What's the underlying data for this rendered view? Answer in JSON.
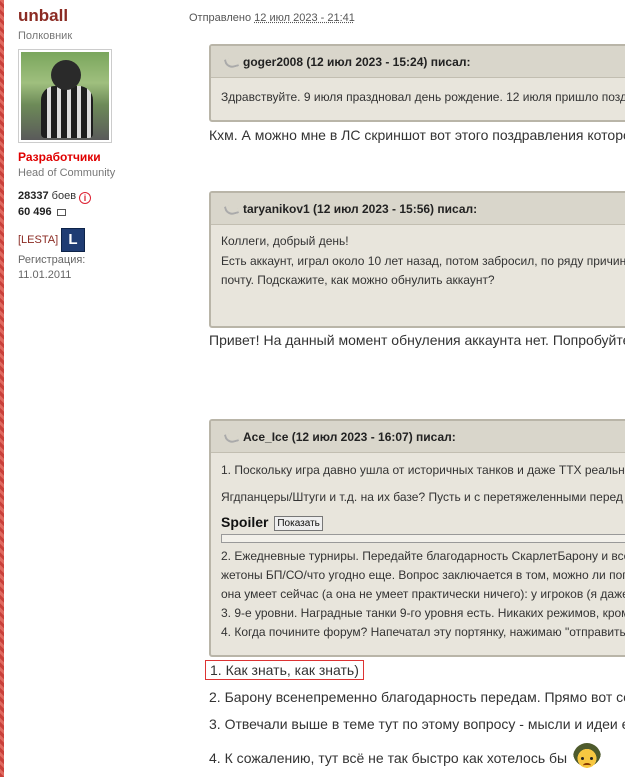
{
  "user": {
    "name": "unball",
    "rank": "Полковник",
    "group": "Разработчики",
    "title": "Head of Community",
    "battles": "28337",
    "battles_label": "боев",
    "posts": "60 496",
    "clan": "[LESTA]",
    "clan_badge": "L",
    "reg_label": "Регистрация:",
    "reg_date": "11.01.2011"
  },
  "post": {
    "sent_label": "Отправлено",
    "sent_date": "12 июл 2023 - 21:41"
  },
  "quotes": [
    {
      "header": "goger2008 (12 июл 2023 - 15:24) писал:",
      "lines": [
        "Здравствуйте. 9 июля праздновал день рождение. 12 июля пришло позд"
      ]
    },
    {
      "header": "taryanikov1 (12 июл 2023 - 15:56) писал:",
      "lines": [
        "Коллеги, добрый день!",
        "Есть аккаунт, играл около 10 лет назад, потом забросил, по ряду причин",
        "почту. Подскажите, как можно обнулить аккаунт?"
      ]
    },
    {
      "header": "Ace_Ice (12 июл 2023 - 16:07) писал:",
      "lines_top": [
        "1. Поскольку игра давно ушла от историчных танков и даже ТТХ реальны",
        "Ягдпанцеры/Штуги и т.д. на их базе? Пусть и с перетяжеленными перед"
      ],
      "spoiler_label": "Spoiler",
      "spoiler_button": "Показать",
      "lines_bottom": [
        "2. Ежедневные турниры. Передайте благодарность СкарлетБарону и все",
        "жетоны БП/СО/что угодно еще. Вопрос заключается в том, можно ли пог",
        "она умеет сейчас (а она не умеет практически ничего): у игроков (я даже",
        "3. 9-е уровни. Наградные танки 9-го уровня есть. Никаких режимов, кром",
        "4. Когда почините форум? Напечатал эту портянку, нажимаю \"отправить"
      ]
    }
  ],
  "replies": {
    "r1": "Кхм. А можно мне в ЛС скриншот вот этого поздравления которо",
    "r2": "Привет! На данный момент обнуления аккаунта нет. Попробуйте",
    "r3_1": "1. Как знать, как знать)",
    "r3_2": "2. Барону всенепременно благодарность передам. Прямо вот се",
    "r3_3": "3. Отвечали выше в теме тут по этому вопросу - мысли и идеи е",
    "r3_4": "4. К сожалению, тут всё не так быстро как хотелось бы"
  }
}
